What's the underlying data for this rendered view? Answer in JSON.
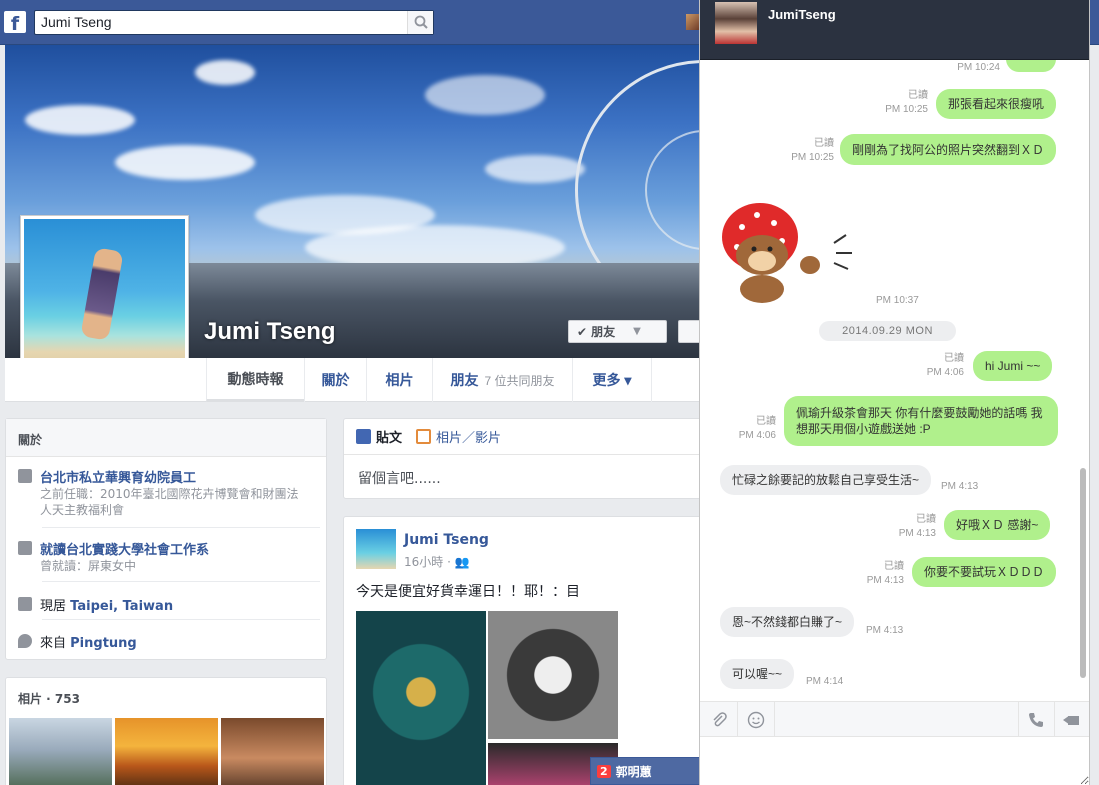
{
  "search": {
    "value": "Jumi Tseng"
  },
  "profile": {
    "name": "Jumi Tseng",
    "friend_button": "朋友"
  },
  "tabs": [
    {
      "label": "動態時報",
      "extra": ""
    },
    {
      "label": "關於",
      "extra": ""
    },
    {
      "label": "相片",
      "extra": ""
    },
    {
      "label": "朋友",
      "extra": "7 位共同朋友"
    },
    {
      "label": "更多 ▾",
      "extra": ""
    }
  ],
  "about": {
    "title": "關於",
    "work_title": "台北市私立華興育幼院員工",
    "work_sub": "之前任職：2010年臺北國際花卉博覽會和財團法人天主教福利會",
    "study_title": "就讀台北實踐大學社會工作系",
    "study_sub": "曾就讀：屏東女中",
    "lives_prefix": "現居",
    "lives_value": "Taipei, Taiwan",
    "from_prefix": "來自",
    "from_value": "Pingtung"
  },
  "photos": {
    "title": "相片 · 753"
  },
  "composer": {
    "tab_post": "貼文",
    "tab_photo": "相片／影片",
    "placeholder": "留個言吧......"
  },
  "post": {
    "author": "Jumi Tseng",
    "time": "16小時 · ",
    "text": "今天是便宜好貨幸運日！！耶！：目"
  },
  "chat_tab": {
    "badge": "2",
    "name": "郭明蕙"
  },
  "chat": {
    "header_name": "JumiTseng",
    "date_separator": "2014.09.29 MON",
    "messages": [
      {
        "dir": "out",
        "text": "那張看起來很瘦吼",
        "read": "已讀",
        "time": "PM 10:25"
      },
      {
        "dir": "out",
        "text": "剛剛為了找阿公的照片突然翻到ＸＤ",
        "read": "已讀",
        "time": "PM 10:25"
      },
      {
        "dir": "in",
        "text": "",
        "read": "",
        "time": "PM 10:37"
      },
      {
        "dir": "out",
        "text": "hi Jumi ~~",
        "read": "已讀",
        "time": "PM 4:06"
      },
      {
        "dir": "out",
        "text": "佩瑜升級茶會那天 你有什麼要鼓勵她的話嗎 我想那天用個小遊戲送她 :P",
        "read": "已讀",
        "time": "PM 4:06"
      },
      {
        "dir": "in",
        "text": "忙碌之餘要記的放鬆自己享受生活~",
        "read": "",
        "time": "PM 4:13"
      },
      {
        "dir": "out",
        "text": "好哦ＸＤ 感謝~",
        "read": "已讀",
        "time": "PM 4:13"
      },
      {
        "dir": "out",
        "text": "你要不要試玩ＸＤＤＤ",
        "read": "已讀",
        "time": "PM 4:13"
      },
      {
        "dir": "in",
        "text": "恩~不然錢都白賺了~",
        "read": "",
        "time": "PM 4:13"
      },
      {
        "dir": "in",
        "text": "可以喔~~",
        "read": "",
        "time": "PM 4:14"
      }
    ],
    "prev_time": "PM 10:24"
  },
  "colors": {
    "brand": "#3b5998",
    "bubble_out": "#b0f08c",
    "bubble_in": "#edeef0"
  }
}
